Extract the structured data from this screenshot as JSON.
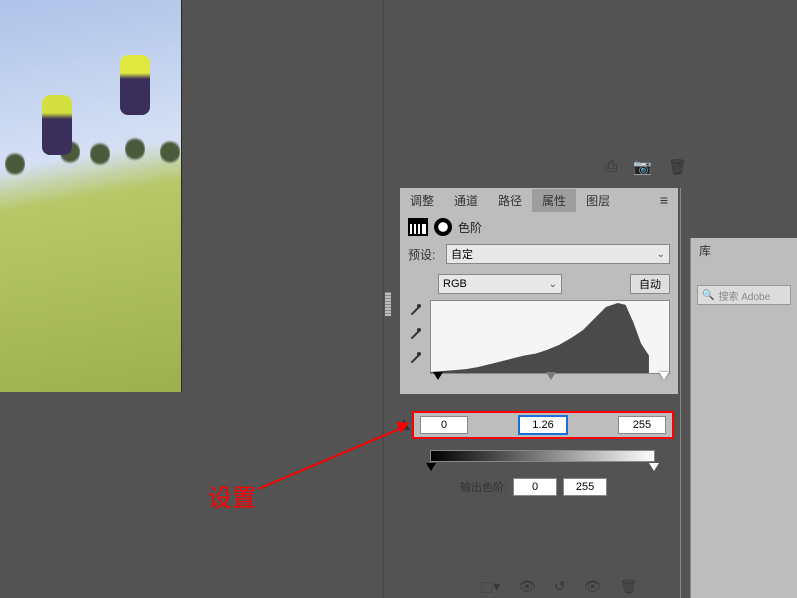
{
  "tabs": {
    "adjustments": "调整",
    "channels": "通道",
    "paths": "路径",
    "properties": "属性",
    "layers": "图层"
  },
  "panel": {
    "title": "色阶",
    "preset_label": "预设:",
    "preset_value": "自定",
    "channel_value": "RGB",
    "auto_label": "自动",
    "input_shadows": "0",
    "input_mid": "1.26",
    "input_highlights": "255",
    "output_label": "输出色阶:",
    "output_shadows": "0",
    "output_highlights": "255"
  },
  "library": {
    "tab": "库",
    "search_placeholder": "搜索 Adobe"
  },
  "annotation": {
    "label": "设置"
  },
  "chart_data": {
    "type": "area",
    "title": "Histogram",
    "xlabel": "",
    "ylabel": "",
    "xlim": [
      0,
      255
    ],
    "x": [
      0,
      16,
      32,
      48,
      64,
      80,
      96,
      112,
      128,
      144,
      160,
      176,
      192,
      208,
      216,
      224,
      232,
      240,
      248,
      255
    ],
    "values": [
      0,
      1,
      2,
      3,
      5,
      8,
      12,
      15,
      18,
      20,
      25,
      32,
      40,
      52,
      68,
      92,
      100,
      96,
      60,
      30
    ]
  }
}
